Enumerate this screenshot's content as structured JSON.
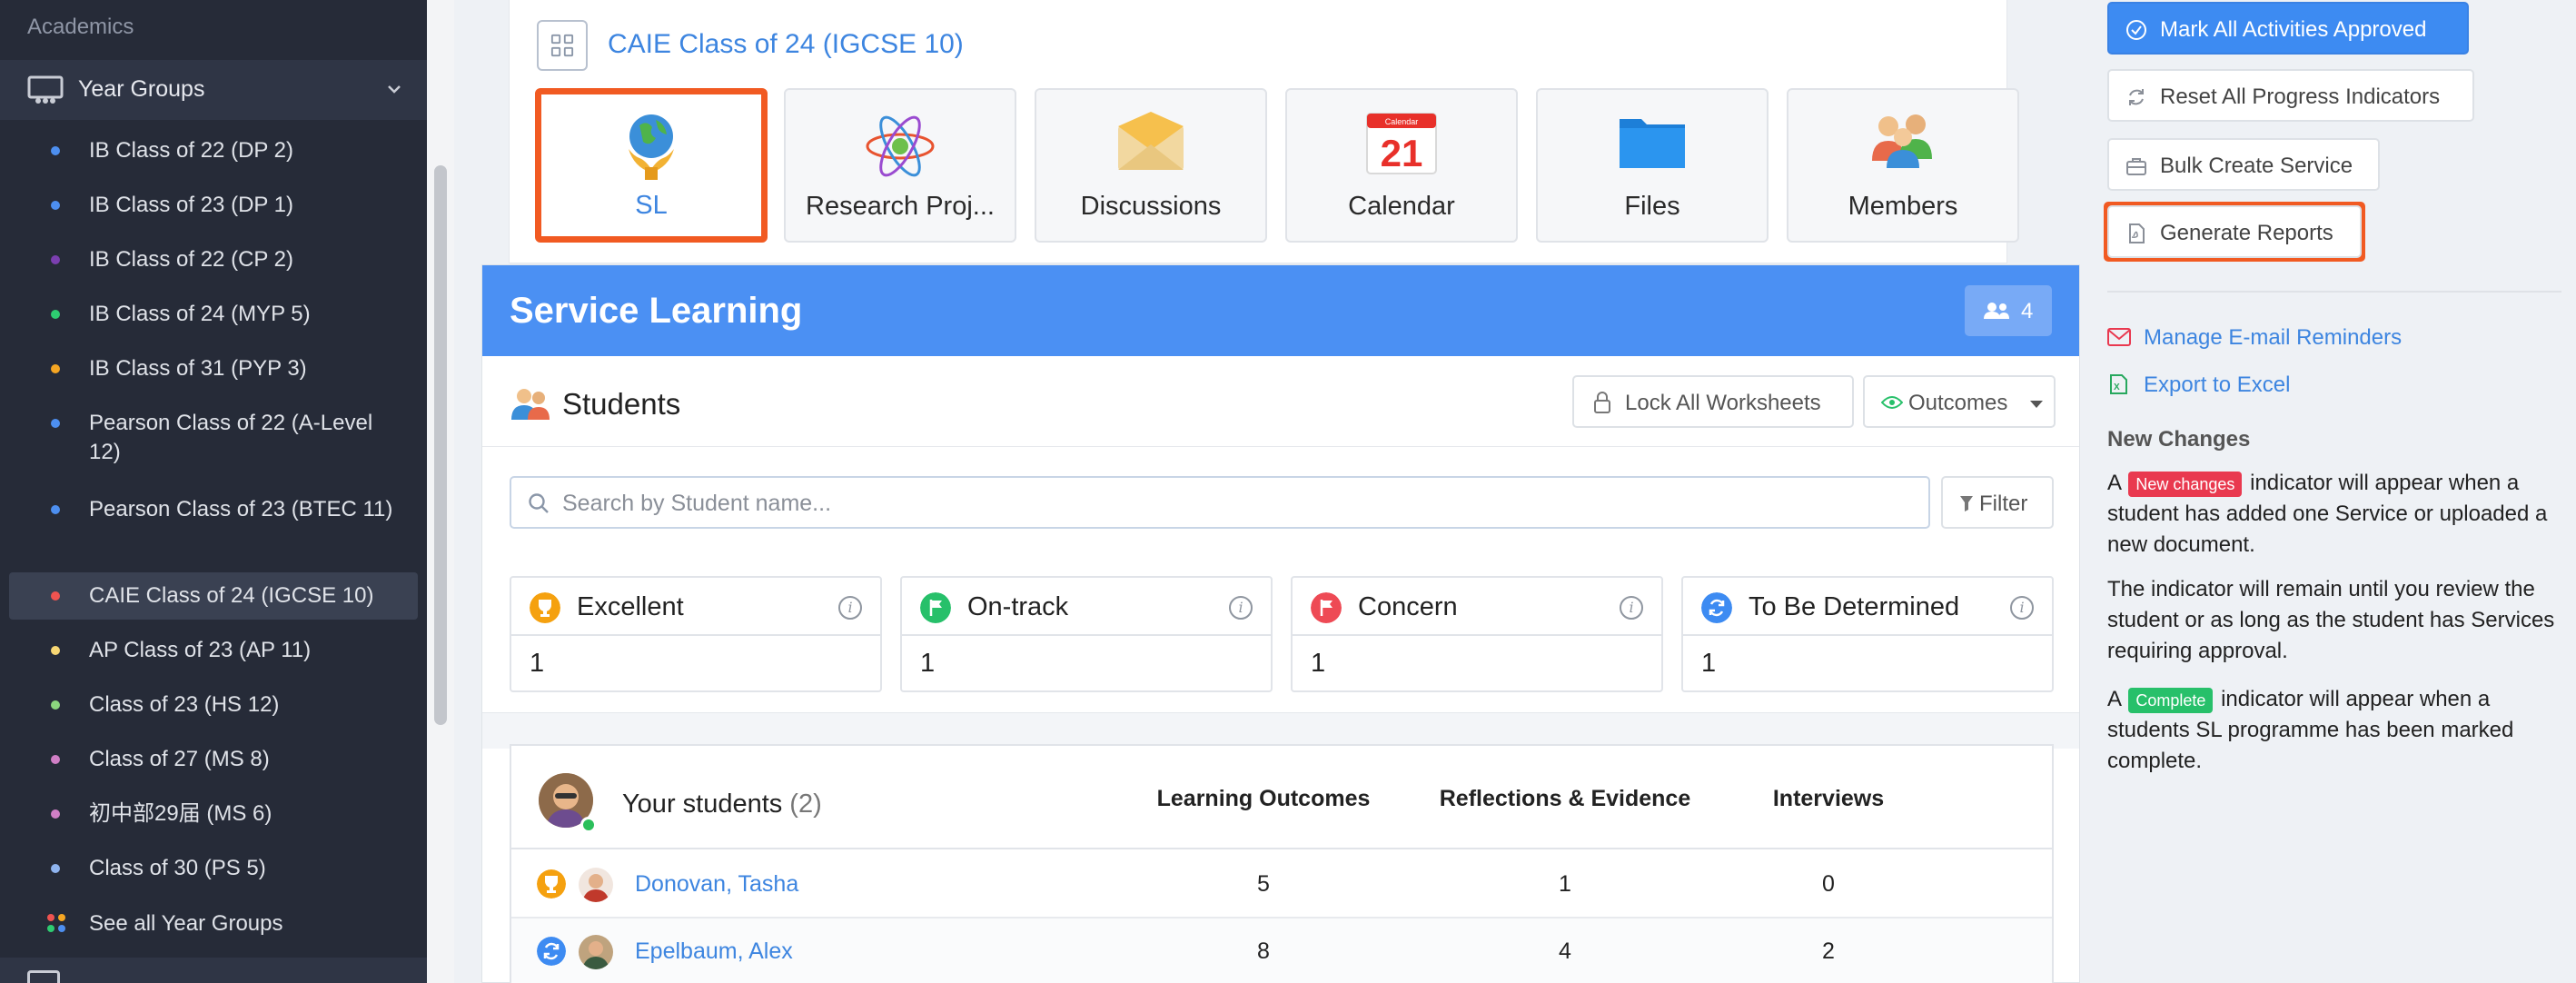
{
  "sidebar": {
    "section_label": "Academics",
    "group_label": "Year Groups",
    "items": [
      {
        "label": "IB Class of 22 (DP 2)",
        "color": "#4d8ff0"
      },
      {
        "label": "IB Class of 23 (DP 1)",
        "color": "#4d8ff0"
      },
      {
        "label": "IB Class of 22 (CP 2)",
        "color": "#7b3fb0"
      },
      {
        "label": "IB Class of 24 (MYP 5)",
        "color": "#2ecc71"
      },
      {
        "label": "IB Class of 31 (PYP 3)",
        "color": "#f5a623"
      },
      {
        "label": "Pearson Class of 22 (A-Level 12)",
        "color": "#4d8ff0"
      },
      {
        "label": "Pearson Class of 23 (BTEC 11)",
        "color": "#4d8ff0"
      },
      {
        "label": "CAIE Class of 24 (IGCSE 10)",
        "color": "#ef5350"
      },
      {
        "label": "AP Class of 23 (AP 11)",
        "color": "#f7d774"
      },
      {
        "label": "Class of 23 (HS 12)",
        "color": "#8bd67e"
      },
      {
        "label": "Class of 27 (MS 8)",
        "color": "#d07fc6"
      },
      {
        "label": "初中部29届 (MS 6)",
        "color": "#d07fc6"
      },
      {
        "label": "Class of 30 (PS 5)",
        "color": "#8fb4ef"
      }
    ],
    "see_all_label": "See all Year Groups"
  },
  "course": {
    "title": "CAIE Class of 24 (IGCSE 10)",
    "tiles": [
      {
        "label": "SL",
        "icon": "globe-hands-icon",
        "selected": true
      },
      {
        "label": "Research Proj...",
        "icon": "atom-icon"
      },
      {
        "label": "Discussions",
        "icon": "envelope-icon"
      },
      {
        "label": "Calendar",
        "icon": "calendar-icon",
        "day": "21",
        "month": "Calendar"
      },
      {
        "label": "Files",
        "icon": "folder-icon"
      },
      {
        "label": "Members",
        "icon": "people-icon"
      }
    ]
  },
  "service": {
    "title": "Service Learning",
    "member_count": "4",
    "students_title": "Students",
    "lock_label": "Lock All Worksheets",
    "outcomes_label": "Outcomes",
    "search_placeholder": "Search by Student name...",
    "filter_label": "Filter",
    "statuses": [
      {
        "label": "Excellent",
        "value": "1",
        "color": "#f5a10f",
        "icon": "trophy-icon"
      },
      {
        "label": "On-track",
        "value": "1",
        "color": "#27c06a",
        "icon": "flag-icon"
      },
      {
        "label": "Concern",
        "value": "1",
        "color": "#ee4a55",
        "icon": "flag-icon"
      },
      {
        "label": "To Be Determined",
        "value": "1",
        "color": "#3d8bf2",
        "icon": "refresh-icon"
      }
    ],
    "table": {
      "title": "Your students",
      "count": "(2)",
      "columns": [
        "Learning Outcomes",
        "Reflections & Evidence",
        "Interviews"
      ],
      "rows": [
        {
          "name": "Donovan, Tasha",
          "status_color": "#f5a10f",
          "values": [
            "5",
            "1",
            "0"
          ]
        },
        {
          "name": "Epelbaum, Alex",
          "status_color": "#3d8bf2",
          "values": [
            "8",
            "4",
            "2"
          ]
        }
      ]
    }
  },
  "right_panel": {
    "mark_approved": "Mark All Activities Approved",
    "reset_progress": "Reset All Progress Indicators",
    "bulk_create": "Bulk Create Service",
    "generate_reports": "Generate Reports",
    "email_reminders": "Manage E-mail Reminders",
    "export_excel": "Export to Excel",
    "new_changes_heading": "New Changes",
    "p1_a": "A",
    "badge_new": "New changes",
    "p1_b": "indicator will appear when a student has added one Service or uploaded a new document.",
    "p2": "The indicator will remain until you review the student or as long as the student has Services requiring approval.",
    "p3_a": "A",
    "badge_complete": "Complete",
    "p3_b": "indicator will appear when a students SL programme has been marked complete."
  }
}
